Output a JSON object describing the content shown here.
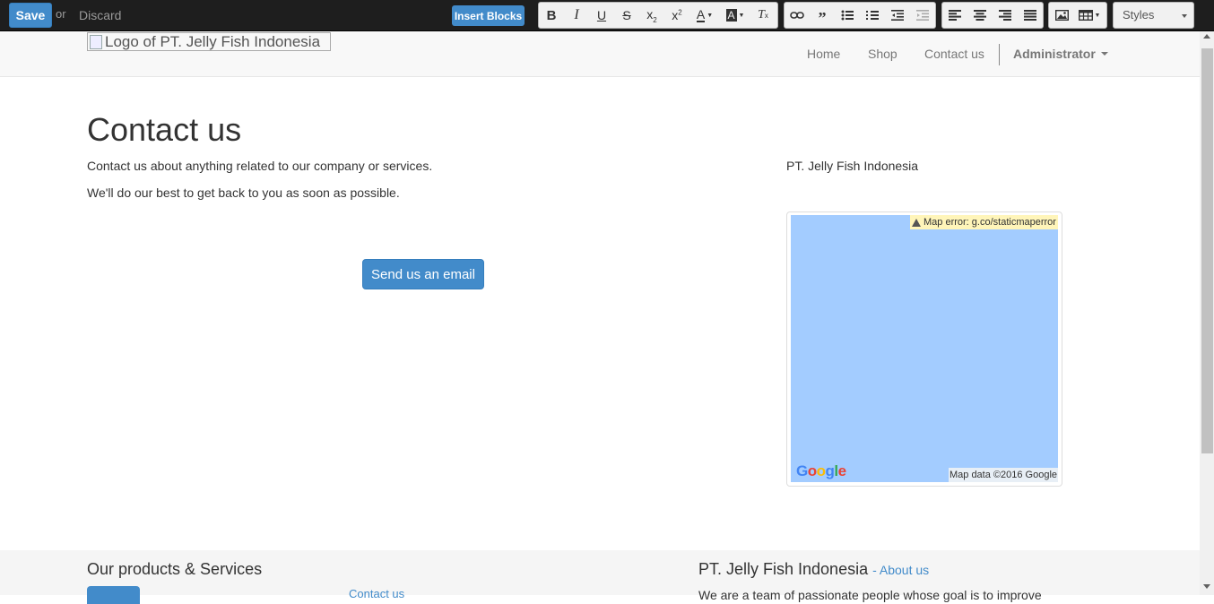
{
  "toolbar": {
    "save_label": "Save",
    "or_label": "or",
    "discard_label": "Discard",
    "insert_blocks_label": "Insert Blocks",
    "styles_label": "Styles",
    "format_buttons": [
      "bold-icon",
      "italic-icon",
      "underline-icon",
      "strikethrough-icon",
      "subscript-icon",
      "superscript-icon",
      "font-color-icon",
      "highlight-color-icon",
      "clear-format-icon"
    ],
    "paragraph_buttons": [
      "link-icon",
      "quote-icon",
      "bulleted-list-icon",
      "numbered-list-icon",
      "outdent-icon",
      "indent-icon"
    ],
    "align_buttons": [
      "align-left-icon",
      "align-center-icon",
      "align-right-icon",
      "align-justify-icon"
    ],
    "insert_buttons": [
      "image-icon",
      "table-icon"
    ],
    "accent_color": "#428bca"
  },
  "navbar": {
    "logo_alt": "Logo of PT. Jelly Fish Indonesia",
    "links": [
      "Home",
      "Shop",
      "Contact us"
    ],
    "user_label": "Administrator"
  },
  "main": {
    "title": "Contact us",
    "intro_line1": "Contact us about anything related to our company or services.",
    "intro_line2": "We'll do our best to get back to you as soon as possible.",
    "email_button": "Send us an email",
    "company_name": "PT. Jelly Fish Indonesia",
    "map": {
      "error_text": "Map error: g.co/staticmaperror",
      "attribution": "Map data ©2016 Google",
      "logo_text": "Google",
      "water_color": "#a3ccff"
    }
  },
  "footer": {
    "products_heading": "Our products & Services",
    "company_heading": "PT. Jelly Fish Indonesia",
    "about_link": "- About us",
    "contact_link": "Contact us",
    "about_text": "We are a team of passionate people whose goal is to improve"
  }
}
